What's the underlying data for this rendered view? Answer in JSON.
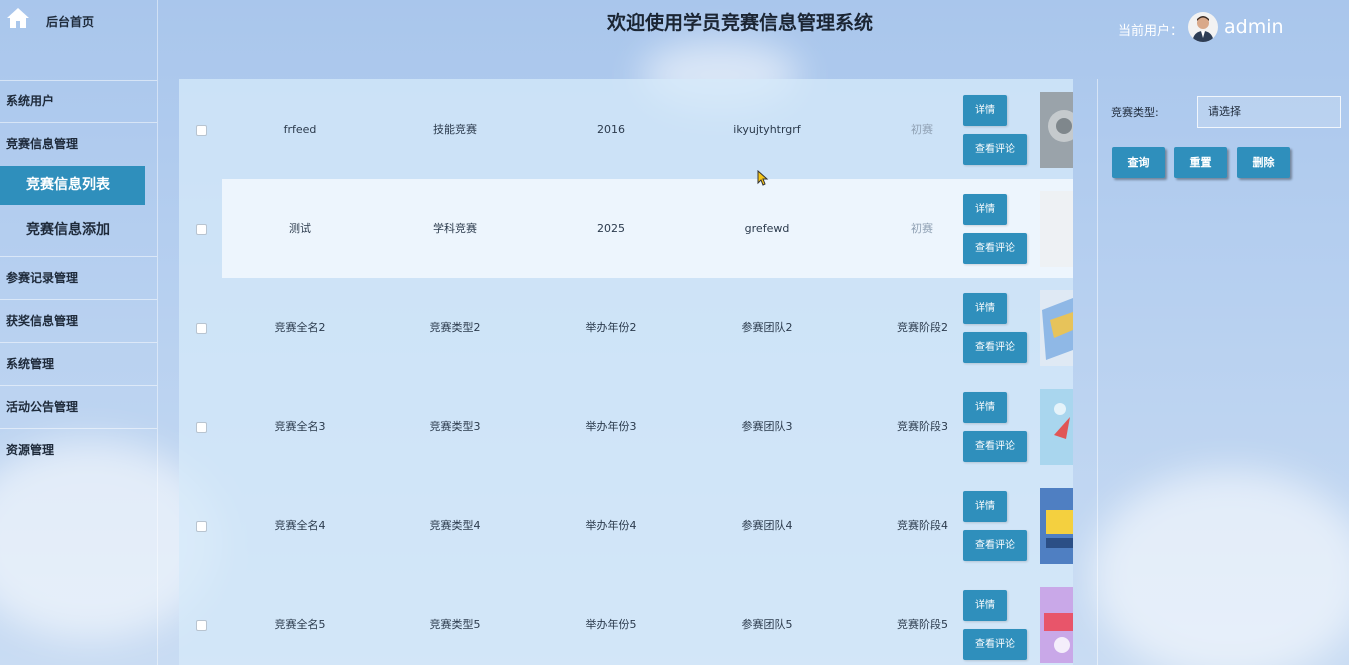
{
  "sidebar": {
    "home_label": "后台首页",
    "items": [
      {
        "label": "系统用户"
      },
      {
        "label": "竞赛信息管理"
      },
      {
        "label": "参赛记录管理"
      },
      {
        "label": "获奖信息管理"
      },
      {
        "label": "系统管理"
      },
      {
        "label": "活动公告管理"
      },
      {
        "label": "资源管理"
      }
    ],
    "submenu": [
      {
        "label": "竞赛信息列表",
        "active": true
      },
      {
        "label": "竞赛信息添加",
        "active": false
      }
    ]
  },
  "header": {
    "title": "欢迎使用学员竞赛信息管理系统",
    "user_label": "当前用户：",
    "user_name": "admin"
  },
  "table": {
    "rows": [
      {
        "name": "frfeed",
        "type": "技能竞赛",
        "year": "2016",
        "team": "ikyujtyhtrgrf",
        "stage": "初赛"
      },
      {
        "name": "测试",
        "type": "学科竞赛",
        "year": "2025",
        "team": "grefewd",
        "stage": "初赛"
      },
      {
        "name": "竞赛全名2",
        "type": "竞赛类型2",
        "year": "举办年份2",
        "team": "参赛团队2",
        "stage": "竞赛阶段2"
      },
      {
        "name": "竞赛全名3",
        "type": "竞赛类型3",
        "year": "举办年份3",
        "team": "参赛团队3",
        "stage": "竞赛阶段3"
      },
      {
        "name": "竞赛全名4",
        "type": "竞赛类型4",
        "year": "举办年份4",
        "team": "参赛团队4",
        "stage": "竞赛阶段4"
      },
      {
        "name": "竞赛全名5",
        "type": "竞赛类型5",
        "year": "举办年份5",
        "team": "参赛团队5",
        "stage": "竞赛阶段5"
      }
    ],
    "detail_label": "详情",
    "comment_label": "查看评论"
  },
  "filter": {
    "type_label": "竞赛类型:",
    "type_placeholder": "请选择",
    "search_label": "查询",
    "reset_label": "重置",
    "delete_label": "删除"
  },
  "colors": {
    "accent": "#2f8fbc",
    "background": "#b7d0f0"
  }
}
